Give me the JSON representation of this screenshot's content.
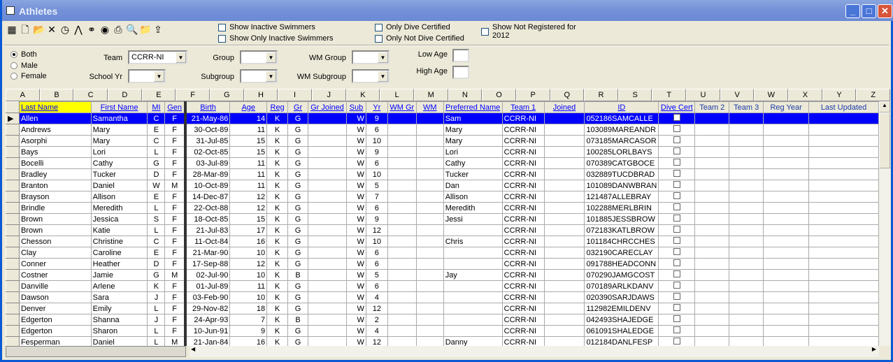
{
  "title": "Athletes",
  "toolbar_icons": [
    "grid-icon",
    "new-icon",
    "open-icon",
    "delete-icon",
    "clock-icon",
    "road-icon",
    "binoculars-icon",
    "eye-icon",
    "print-icon",
    "preview-icon",
    "folder-icon",
    "export-icon"
  ],
  "checks": {
    "inactive": "Show Inactive Swimmers",
    "only_inactive": "Show Only Inactive Swimmers",
    "dive": "Only Dive Certified",
    "not_dive": "Only Not Dive Certified",
    "not_reg": "Show Not Registered for",
    "not_reg2": "2012"
  },
  "gender": {
    "both": "Both",
    "male": "Male",
    "female": "Female",
    "selected": "Both"
  },
  "filters": {
    "team_label": "Team",
    "team_value": "CCRR-NI",
    "school_label": "School Yr",
    "group_label": "Group",
    "subgroup_label": "Subgroup",
    "wmgroup_label": "WM Group",
    "wmsub_label": "WM Subgroup",
    "low_label": "Low Age",
    "high_label": "High Age"
  },
  "letters": [
    "A",
    "B",
    "C",
    "D",
    "E",
    "F",
    "G",
    "H",
    "I",
    "J",
    "K",
    "L",
    "M",
    "N",
    "O",
    "P",
    "Q",
    "R",
    "S",
    "T",
    "U",
    "V",
    "W",
    "X",
    "Y",
    "Z"
  ],
  "columns": [
    "Last Name",
    "First Name",
    "MI",
    "Gen",
    "Birth",
    "Age",
    "Reg",
    "Gr",
    "Gr Joined",
    "Sub",
    "Yr",
    "WM Gr",
    "WM",
    "Preferred Name",
    "Team 1",
    "Joined",
    "ID",
    "Dive Cert",
    "Team 2",
    "Team 3",
    "Reg Year",
    "Last Updated"
  ],
  "rows": [
    [
      "Allen",
      "Samantha",
      "C",
      "F",
      "21-May-86",
      "14",
      "K",
      "G",
      "",
      "W",
      "9",
      "",
      "",
      "Sam",
      "CCRR-NI",
      "",
      "052186SAMCALLE"
    ],
    [
      "Andrews",
      "Mary",
      "E",
      "F",
      "30-Oct-89",
      "11",
      "K",
      "G",
      "",
      "W",
      "6",
      "",
      "",
      "Mary",
      "CCRR-NI",
      "",
      "103089MAREANDR"
    ],
    [
      "Asorphi",
      "Mary",
      "C",
      "F",
      "31-Jul-85",
      "15",
      "K",
      "G",
      "",
      "W",
      "10",
      "",
      "",
      "Mary",
      "CCRR-NI",
      "",
      "073185MARCASOR"
    ],
    [
      "Bays",
      "Lori",
      "L",
      "F",
      "02-Oct-85",
      "15",
      "K",
      "G",
      "",
      "W",
      "9",
      "",
      "",
      "Lori",
      "CCRR-NI",
      "",
      "100285LORLBAYS"
    ],
    [
      "Bocelli",
      "Cathy",
      "G",
      "F",
      "03-Jul-89",
      "11",
      "K",
      "G",
      "",
      "W",
      "6",
      "",
      "",
      "Cathy",
      "CCRR-NI",
      "",
      "070389CATGBOCE"
    ],
    [
      "Bradley",
      "Tucker",
      "D",
      "F",
      "28-Mar-89",
      "11",
      "K",
      "G",
      "",
      "W",
      "10",
      "",
      "",
      "Tucker",
      "CCRR-NI",
      "",
      "032889TUCDBRAD"
    ],
    [
      "Branton",
      "Daniel",
      "W",
      "M",
      "10-Oct-89",
      "11",
      "K",
      "G",
      "",
      "W",
      "5",
      "",
      "",
      "Dan",
      "CCRR-NI",
      "",
      "101089DANWBRAN"
    ],
    [
      "Brayson",
      "Allison",
      "E",
      "F",
      "14-Dec-87",
      "12",
      "K",
      "G",
      "",
      "W",
      "7",
      "",
      "",
      "Allison",
      "CCRR-NI",
      "",
      "121487ALLEBRAY"
    ],
    [
      "Brindle",
      "Meredith",
      "L",
      "F",
      "22-Oct-88",
      "12",
      "K",
      "G",
      "",
      "W",
      "6",
      "",
      "",
      "Meredith",
      "CCRR-NI",
      "",
      "102288MERLBRIN"
    ],
    [
      "Brown",
      "Jessica",
      "S",
      "F",
      "18-Oct-85",
      "15",
      "K",
      "G",
      "",
      "W",
      "9",
      "",
      "",
      "Jessi",
      "CCRR-NI",
      "",
      "101885JESSBROW"
    ],
    [
      "Brown",
      "Katie",
      "L",
      "F",
      "21-Jul-83",
      "17",
      "K",
      "G",
      "",
      "W",
      "12",
      "",
      "",
      "",
      "CCRR-NI",
      "",
      "072183KATLBROW"
    ],
    [
      "Chesson",
      "Christine",
      "C",
      "F",
      "11-Oct-84",
      "16",
      "K",
      "G",
      "",
      "W",
      "10",
      "",
      "",
      "Chris",
      "CCRR-NI",
      "",
      "101184CHRCCHES"
    ],
    [
      "Clay",
      "Caroline",
      "E",
      "F",
      "21-Mar-90",
      "10",
      "K",
      "G",
      "",
      "W",
      "6",
      "",
      "",
      "",
      "CCRR-NI",
      "",
      "032190CARECLAY"
    ],
    [
      "Conner",
      "Heather",
      "D",
      "F",
      "17-Sep-88",
      "12",
      "K",
      "G",
      "",
      "W",
      "6",
      "",
      "",
      "",
      "CCRR-NI",
      "",
      "091788HEADCONN"
    ],
    [
      "Costner",
      "Jamie",
      "G",
      "M",
      "02-Jul-90",
      "10",
      "K",
      "B",
      "",
      "W",
      "5",
      "",
      "",
      "Jay",
      "CCRR-NI",
      "",
      "070290JAMGCOST"
    ],
    [
      "Danville",
      "Arlene",
      "K",
      "F",
      "01-Jul-89",
      "11",
      "K",
      "G",
      "",
      "W",
      "6",
      "",
      "",
      "",
      "CCRR-NI",
      "",
      "070189ARLKDANV"
    ],
    [
      "Dawson",
      "Sara",
      "J",
      "F",
      "03-Feb-90",
      "10",
      "K",
      "G",
      "",
      "W",
      "4",
      "",
      "",
      "",
      "CCRR-NI",
      "",
      "020390SARJDAWS"
    ],
    [
      "Denver",
      "Emily",
      "L",
      "F",
      "29-Nov-82",
      "18",
      "K",
      "G",
      "",
      "W",
      "12",
      "",
      "",
      "",
      "CCRR-NI",
      "",
      "112982EMILDENV"
    ],
    [
      "Edgerton",
      "Shanna",
      "J",
      "F",
      "24-Apr-93",
      "7",
      "K",
      "B",
      "",
      "W",
      "2",
      "",
      "",
      "",
      "CCRR-NI",
      "",
      "042493SHAJEDGE"
    ],
    [
      "Edgerton",
      "Sharon",
      "L",
      "F",
      "10-Jun-91",
      "9",
      "K",
      "G",
      "",
      "W",
      "4",
      "",
      "",
      "",
      "CCRR-NI",
      "",
      "061091SHALEDGE"
    ],
    [
      "Fesperman",
      "Daniel",
      "L",
      "M",
      "21-Jan-84",
      "16",
      "K",
      "G",
      "",
      "W",
      "12",
      "",
      "",
      "Danny",
      "CCRR-NI",
      "",
      "012184DANLFESP"
    ]
  ]
}
